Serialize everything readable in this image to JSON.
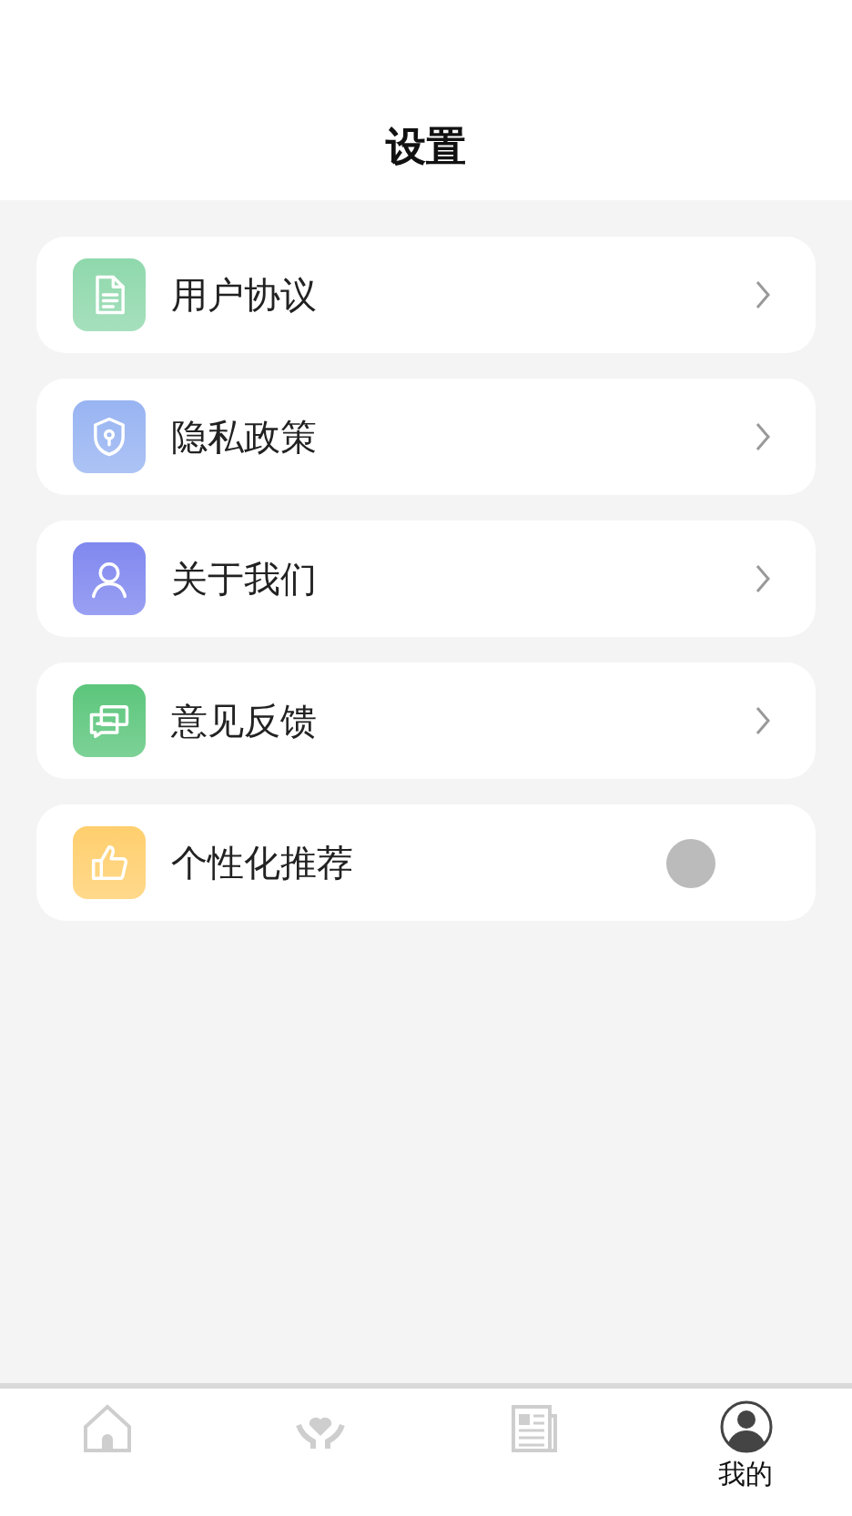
{
  "header": {
    "title": "设置"
  },
  "items": [
    {
      "kind": "link",
      "label": "用户协议",
      "color": "#8fd8ac"
    },
    {
      "kind": "link",
      "label": "隐私政策",
      "color": "#98b4f2"
    },
    {
      "kind": "link",
      "label": "关于我们",
      "color": "#8088ef"
    },
    {
      "kind": "link",
      "label": "意见反馈",
      "color": "#5cc67c"
    },
    {
      "kind": "toggle",
      "label": "个性化推荐",
      "color": "#ffcf6e",
      "on": false
    }
  ],
  "tabs": [
    {
      "kind": "home",
      "selected": false
    },
    {
      "kind": "care",
      "selected": false
    },
    {
      "kind": "news",
      "selected": false
    },
    {
      "kind": "profile",
      "selected": true,
      "label": "我的"
    }
  ]
}
